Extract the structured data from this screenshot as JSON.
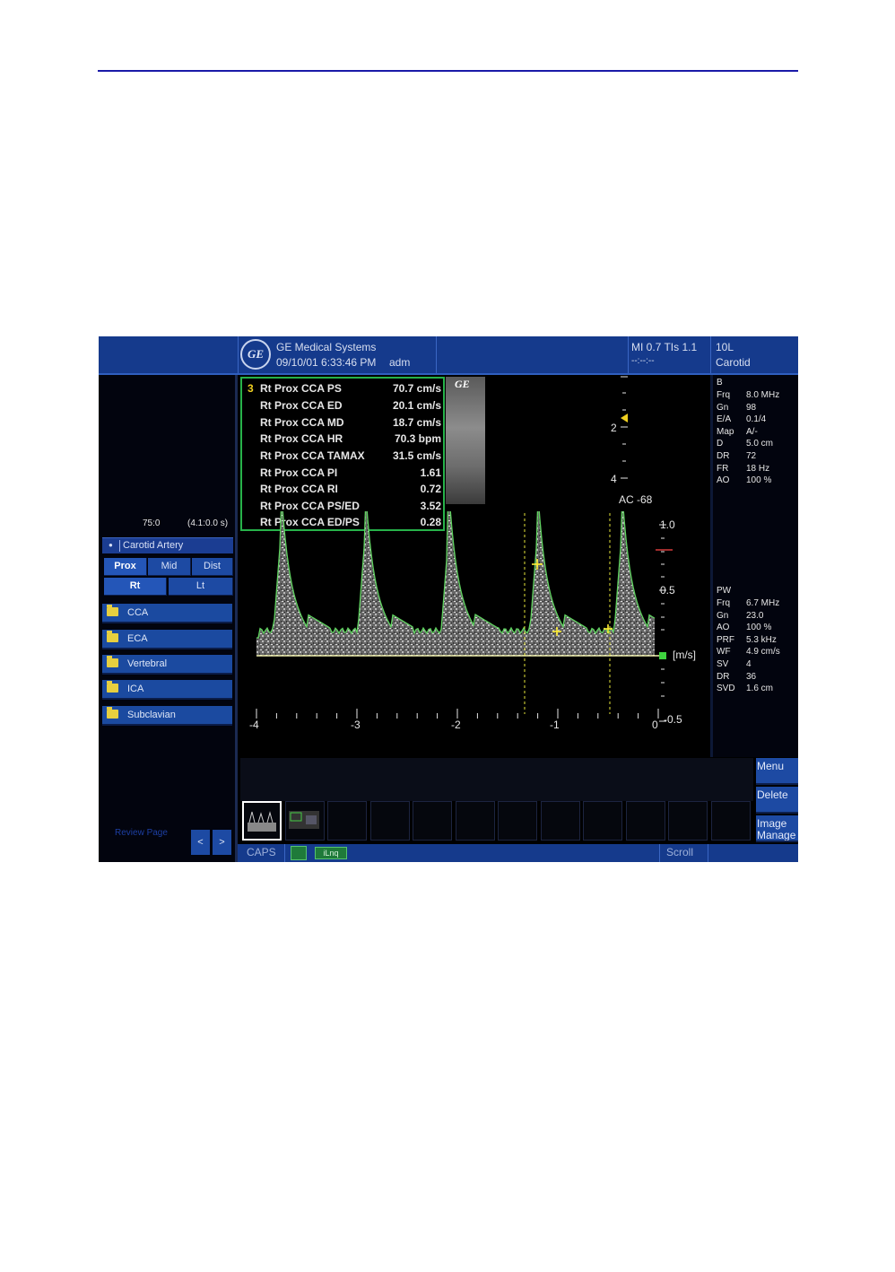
{
  "header": {
    "company": "GE Medical Systems",
    "datetime": "09/10/01 6:33:46 PM",
    "user": "adm",
    "mi_tis": "MI 0.7 TIs 1.1",
    "time_placeholder": "--:--:--",
    "probe": "10L",
    "preset": "Carotid",
    "logo_text": "GE"
  },
  "left_panel": {
    "frame_info": "75:0",
    "time_info": "(4.1:0.0 s)",
    "carotid_title": "Carotid Artery",
    "position_buttons": [
      "Prox",
      "Mid",
      "Dist"
    ],
    "side_buttons": [
      "Rt",
      "Lt"
    ],
    "vessels": [
      "CCA",
      "ECA",
      "Vertebral",
      "ICA",
      "Subclavian"
    ],
    "review_page": "Review Page",
    "prev": "<",
    "next": ">"
  },
  "measurements": {
    "index": "3",
    "rows": [
      {
        "label": "Rt Prox CCA PS",
        "value": "70.7 cm/s"
      },
      {
        "label": "Rt Prox CCA ED",
        "value": "20.1 cm/s"
      },
      {
        "label": "Rt Prox CCA MD",
        "value": "18.7 cm/s"
      },
      {
        "label": "Rt Prox CCA HR",
        "value": "70.3 bpm"
      },
      {
        "label": "Rt Prox CCA TAMAX",
        "value": "31.5 cm/s"
      },
      {
        "label": "Rt Prox CCA PI",
        "value": "1.61"
      },
      {
        "label": "Rt Prox CCA RI",
        "value": "0.72"
      },
      {
        "label": "Rt Prox CCA PS/ED",
        "value": "3.52"
      },
      {
        "label": "Rt Prox CCA ED/PS",
        "value": "0.28"
      }
    ]
  },
  "thumbnail_logo": "GE",
  "depth_scale": {
    "marks": [
      "2",
      "4"
    ],
    "ac": "AC -68"
  },
  "doppler": {
    "velocity_ticks": [
      "1.0",
      "0.5",
      "-0.5"
    ],
    "unit": "[m/s]",
    "time_ticks": [
      "-4",
      "-3",
      "-2",
      "-1",
      "0"
    ]
  },
  "b_mode": {
    "title": "B",
    "params": [
      {
        "k": "Frq",
        "v": "8.0 MHz"
      },
      {
        "k": "Gn",
        "v": "98"
      },
      {
        "k": "E/A",
        "v": "0.1/4"
      },
      {
        "k": "Map",
        "v": "A/-"
      },
      {
        "k": "D",
        "v": "5.0 cm"
      },
      {
        "k": "DR",
        "v": "72"
      },
      {
        "k": "FR",
        "v": "18 Hz"
      },
      {
        "k": "AO",
        "v": "100 %"
      }
    ]
  },
  "pw_mode": {
    "title": "PW",
    "params": [
      {
        "k": "Frq",
        "v": "6.7 MHz"
      },
      {
        "k": "Gn",
        "v": "23.0"
      },
      {
        "k": "AO",
        "v": "100 %"
      },
      {
        "k": "PRF",
        "v": "5.3 kHz"
      },
      {
        "k": "WF",
        "v": "4.9 cm/s"
      },
      {
        "k": "SV",
        "v": "4"
      },
      {
        "k": "DR",
        "v": "36"
      },
      {
        "k": "SVD",
        "v": "1.6 cm"
      }
    ]
  },
  "menu_buttons": {
    "menu": "Menu",
    "delete": "Delete",
    "image_manage": "Image Manage"
  },
  "status_bar": {
    "caps": "CAPS",
    "chip": "iLnq",
    "scroll": "Scroll"
  },
  "colors": {
    "header_bg": "#153a8c",
    "button_bg": "#1d4aa3",
    "measure_border": "#27b24a",
    "trace": "#5fd35f",
    "cursor": "#ffee33"
  }
}
